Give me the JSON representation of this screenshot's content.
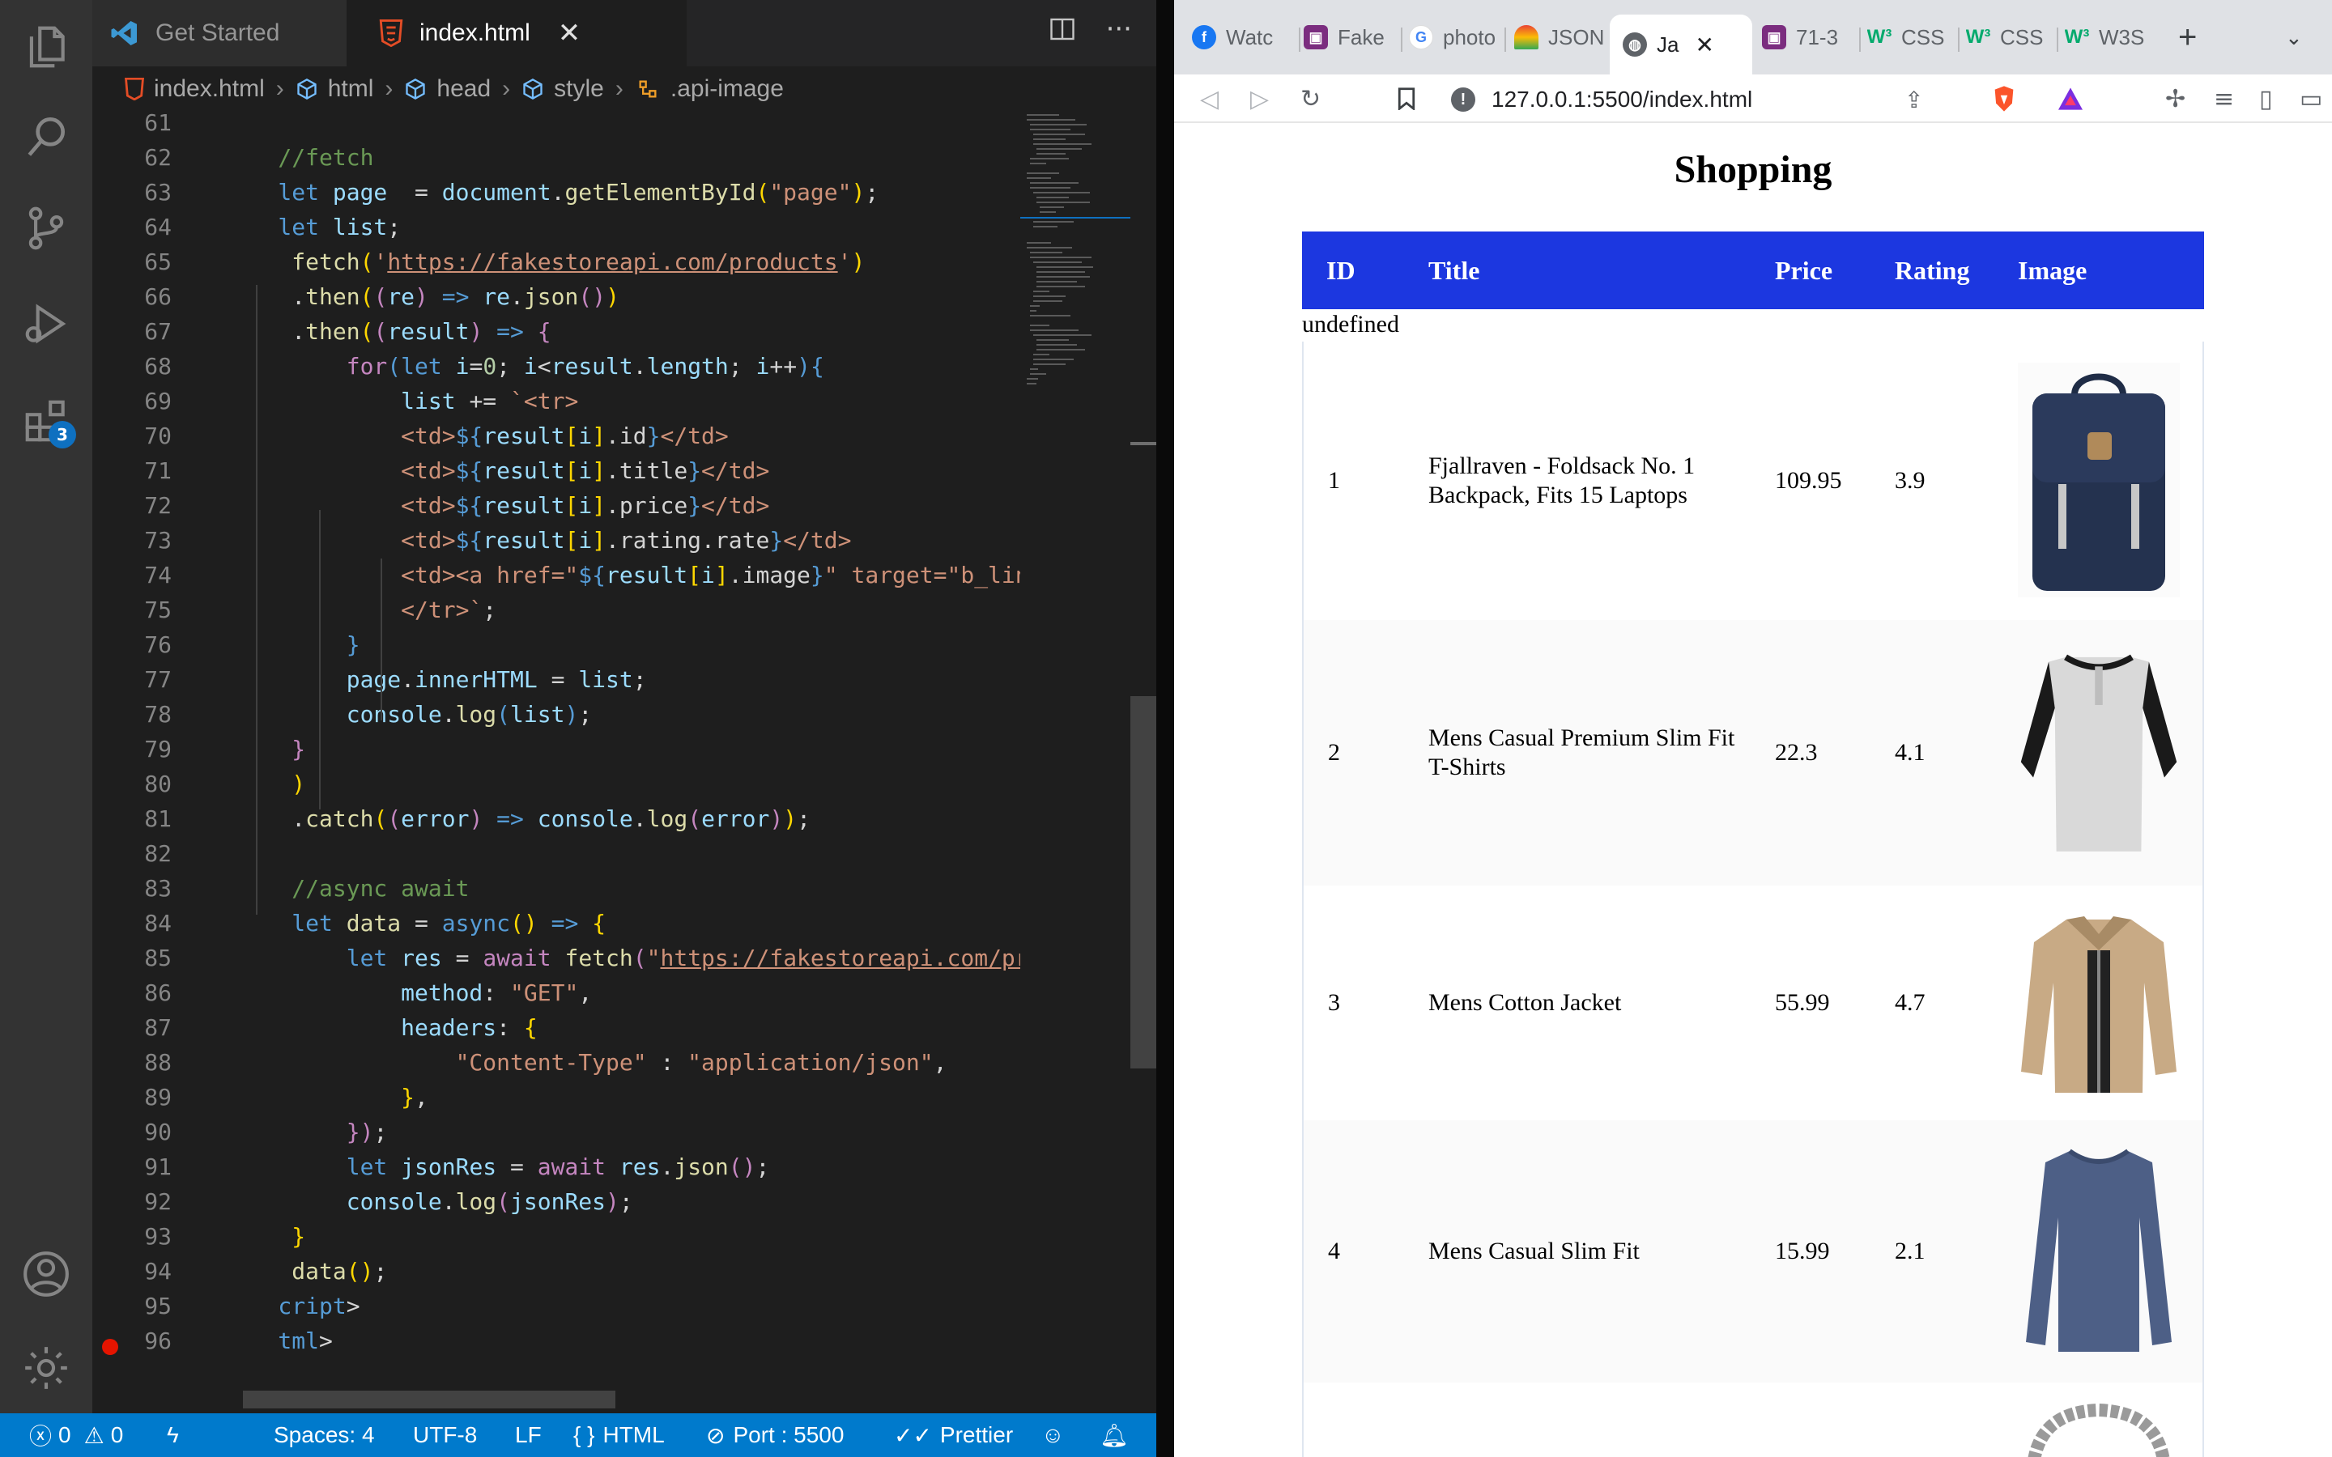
{
  "editor": {
    "tabs": [
      {
        "label": "Get Started"
      },
      {
        "label": "index.html"
      }
    ],
    "breadcrumb": [
      "index.html",
      "html",
      "head",
      "style",
      ".api-image"
    ],
    "activity_badge": "3",
    "lines": [
      {
        "n": "61",
        "segs": []
      },
      {
        "n": "62",
        "segs": [
          [
            "c",
            "    //fetch"
          ]
        ]
      },
      {
        "n": "63",
        "segs": [
          [
            "k",
            "    let "
          ],
          [
            "v",
            "page"
          ],
          [
            "",
            "  = "
          ],
          [
            "v",
            "document"
          ],
          [
            "",
            "."
          ],
          [
            "f",
            "getElementById"
          ],
          [
            "p",
            "("
          ],
          [
            "s",
            "\"page\""
          ],
          [
            "p",
            ")"
          ],
          [
            "",
            ";"
          ]
        ]
      },
      {
        "n": "64",
        "segs": [
          [
            "k",
            "    let "
          ],
          [
            "v",
            "list"
          ],
          [
            "",
            ";"
          ]
        ]
      },
      {
        "n": "65",
        "segs": [
          [
            "",
            "     "
          ],
          [
            "f",
            "fetch"
          ],
          [
            "p",
            "("
          ],
          [
            "s",
            "'"
          ],
          [
            "u",
            "https://fakestoreapi.com/products"
          ],
          [
            "s",
            "'"
          ],
          [
            "p",
            ")"
          ]
        ]
      },
      {
        "n": "66",
        "segs": [
          [
            "",
            "     ."
          ],
          [
            "f",
            "then"
          ],
          [
            "p",
            "("
          ],
          [
            "kw",
            "("
          ],
          [
            "v",
            "re"
          ],
          [
            "kw",
            ")"
          ],
          [
            "k",
            " => "
          ],
          [
            "v",
            "re"
          ],
          [
            "",
            "."
          ],
          [
            "f",
            "json"
          ],
          [
            "kw",
            "()"
          ],
          [
            "p",
            ")"
          ]
        ]
      },
      {
        "n": "67",
        "segs": [
          [
            "",
            "     ."
          ],
          [
            "f",
            "then"
          ],
          [
            "p",
            "("
          ],
          [
            "kw",
            "("
          ],
          [
            "v",
            "result"
          ],
          [
            "kw",
            ")"
          ],
          [
            "k",
            " => "
          ],
          [
            "kw",
            "{"
          ]
        ]
      },
      {
        "n": "68",
        "segs": [
          [
            "kw",
            "         for"
          ],
          [
            "k",
            "("
          ],
          [
            "k",
            "let "
          ],
          [
            "v",
            "i"
          ],
          [
            "",
            "="
          ],
          [
            "n",
            "0"
          ],
          [
            "",
            "; "
          ],
          [
            "v",
            "i"
          ],
          [
            "",
            "<"
          ],
          [
            "v",
            "result"
          ],
          [
            "",
            "."
          ],
          [
            "v",
            "length"
          ],
          [
            "",
            "; "
          ],
          [
            "v",
            "i"
          ],
          [
            "",
            "++"
          ],
          [
            "k",
            ")"
          ],
          [
            "k",
            "{"
          ]
        ]
      },
      {
        "n": "69",
        "segs": [
          [
            "v",
            "             list "
          ],
          [
            "",
            "+= "
          ],
          [
            "s",
            "`<tr>"
          ]
        ]
      },
      {
        "n": "70",
        "segs": [
          [
            "s",
            "             <td>"
          ],
          [
            "k",
            "${"
          ],
          [
            "v",
            "result"
          ],
          [
            "p",
            "["
          ],
          [
            "v",
            "i"
          ],
          [
            "p",
            "]"
          ],
          [
            "",
            ".id"
          ],
          [
            "k",
            "}"
          ],
          [
            "s",
            "</td>"
          ]
        ]
      },
      {
        "n": "71",
        "segs": [
          [
            "s",
            "             <td>"
          ],
          [
            "k",
            "${"
          ],
          [
            "v",
            "result"
          ],
          [
            "p",
            "["
          ],
          [
            "v",
            "i"
          ],
          [
            "p",
            "]"
          ],
          [
            "",
            ".title"
          ],
          [
            "k",
            "}"
          ],
          [
            "s",
            "</td>"
          ]
        ]
      },
      {
        "n": "72",
        "segs": [
          [
            "s",
            "             <td>"
          ],
          [
            "k",
            "${"
          ],
          [
            "v",
            "result"
          ],
          [
            "p",
            "["
          ],
          [
            "v",
            "i"
          ],
          [
            "p",
            "]"
          ],
          [
            "",
            ".price"
          ],
          [
            "k",
            "}"
          ],
          [
            "s",
            "</td>"
          ]
        ]
      },
      {
        "n": "73",
        "segs": [
          [
            "s",
            "             <td>"
          ],
          [
            "k",
            "${"
          ],
          [
            "v",
            "result"
          ],
          [
            "p",
            "["
          ],
          [
            "v",
            "i"
          ],
          [
            "p",
            "]"
          ],
          [
            "",
            ".rating.rate"
          ],
          [
            "k",
            "}"
          ],
          [
            "s",
            "</td>"
          ]
        ]
      },
      {
        "n": "74",
        "segs": [
          [
            "s",
            "             <td><a href=\""
          ],
          [
            "k",
            "${"
          ],
          [
            "v",
            "result"
          ],
          [
            "p",
            "["
          ],
          [
            "v",
            "i"
          ],
          [
            "p",
            "]"
          ],
          [
            "",
            ".image"
          ],
          [
            "k",
            "}"
          ],
          [
            "s",
            "\" target=\"b_link\""
          ]
        ]
      },
      {
        "n": "75",
        "segs": [
          [
            "s",
            "             </tr>`"
          ],
          [
            "",
            ";"
          ]
        ]
      },
      {
        "n": "76",
        "segs": [
          [
            "k",
            "         }"
          ]
        ]
      },
      {
        "n": "77",
        "segs": [
          [
            "v",
            "         page"
          ],
          [
            "",
            "."
          ],
          [
            "v",
            "innerHTML"
          ],
          [
            "",
            " = "
          ],
          [
            "v",
            "list"
          ],
          [
            "",
            ";"
          ]
        ]
      },
      {
        "n": "78",
        "segs": [
          [
            "v",
            "         console"
          ],
          [
            "",
            "."
          ],
          [
            "f",
            "log"
          ],
          [
            "k",
            "("
          ],
          [
            "v",
            "list"
          ],
          [
            "k",
            ")"
          ],
          [
            "",
            ";"
          ]
        ]
      },
      {
        "n": "79",
        "segs": [
          [
            "kw",
            "     }"
          ]
        ]
      },
      {
        "n": "80",
        "segs": [
          [
            "p",
            "     )"
          ]
        ]
      },
      {
        "n": "81",
        "segs": [
          [
            "",
            "     ."
          ],
          [
            "f",
            "catch"
          ],
          [
            "p",
            "("
          ],
          [
            "kw",
            "("
          ],
          [
            "v",
            "error"
          ],
          [
            "kw",
            ")"
          ],
          [
            "k",
            " => "
          ],
          [
            "v",
            "console"
          ],
          [
            "",
            "."
          ],
          [
            "f",
            "log"
          ],
          [
            "kw",
            "("
          ],
          [
            "v",
            "error"
          ],
          [
            "kw",
            ")"
          ],
          [
            "p",
            ")"
          ],
          [
            "",
            ";"
          ]
        ]
      },
      {
        "n": "82",
        "segs": []
      },
      {
        "n": "83",
        "segs": [
          [
            "c",
            "     //async await"
          ]
        ]
      },
      {
        "n": "84",
        "segs": [
          [
            "k",
            "     let "
          ],
          [
            "f",
            "data"
          ],
          [
            "",
            " = "
          ],
          [
            "k",
            "async"
          ],
          [
            "p",
            "()"
          ],
          [
            "k",
            " => "
          ],
          [
            "p",
            "{"
          ]
        ]
      },
      {
        "n": "85",
        "segs": [
          [
            "k",
            "         let "
          ],
          [
            "v",
            "res"
          ],
          [
            "",
            " = "
          ],
          [
            "kw",
            "await "
          ],
          [
            "f",
            "fetch"
          ],
          [
            "kw",
            "("
          ],
          [
            "s",
            "\""
          ],
          [
            "u",
            "https://fakestoreapi.com/prod"
          ]
        ]
      },
      {
        "n": "86",
        "segs": [
          [
            "v",
            "             method"
          ],
          [
            "",
            ": "
          ],
          [
            "s",
            "\"GET\""
          ],
          [
            "",
            ","
          ]
        ]
      },
      {
        "n": "87",
        "segs": [
          [
            "v",
            "             headers"
          ],
          [
            "",
            ": "
          ],
          [
            "p",
            "{"
          ]
        ]
      },
      {
        "n": "88",
        "segs": [
          [
            "s",
            "                 \"Content-Type\""
          ],
          [
            "",
            " : "
          ],
          [
            "s",
            "\"application/json\""
          ],
          [
            "",
            ","
          ]
        ]
      },
      {
        "n": "89",
        "segs": [
          [
            "p",
            "             }"
          ],
          [
            "",
            ","
          ]
        ]
      },
      {
        "n": "90",
        "segs": [
          [
            "kw",
            "         })"
          ],
          [
            "",
            ";"
          ]
        ]
      },
      {
        "n": "91",
        "segs": [
          [
            "k",
            "         let "
          ],
          [
            "v",
            "jsonRes"
          ],
          [
            "",
            " = "
          ],
          [
            "kw",
            "await "
          ],
          [
            "v",
            "res"
          ],
          [
            "",
            "."
          ],
          [
            "f",
            "json"
          ],
          [
            "kw",
            "()"
          ],
          [
            "",
            ";"
          ]
        ]
      },
      {
        "n": "92",
        "segs": [
          [
            "v",
            "         console"
          ],
          [
            "",
            "."
          ],
          [
            "f",
            "log"
          ],
          [
            "kw",
            "("
          ],
          [
            "v",
            "jsonRes"
          ],
          [
            "kw",
            ")"
          ],
          [
            "",
            ";"
          ]
        ]
      },
      {
        "n": "93",
        "segs": [
          [
            "p",
            "     }"
          ]
        ]
      },
      {
        "n": "94",
        "segs": [
          [
            "f",
            "     data"
          ],
          [
            "p",
            "()"
          ],
          [
            "",
            ";"
          ]
        ]
      },
      {
        "n": "95",
        "segs": [
          [
            "t",
            "    cript"
          ],
          [
            "",
            ">"
          ]
        ]
      },
      {
        "n": "96",
        "segs": [
          [
            "t",
            "    tml"
          ],
          [
            "",
            ">"
          ]
        ]
      }
    ],
    "status": {
      "errors": "0",
      "warnings": "0",
      "spaces": "Spaces: 4",
      "encoding": "UTF-8",
      "eol": "LF",
      "language": "HTML",
      "port": "Port : 5500",
      "formatter": "Prettier"
    }
  },
  "browser": {
    "tabs": [
      {
        "label": "Watc",
        "icon": "facebook-icon",
        "color": "#1877f2"
      },
      {
        "label": "Fake",
        "icon": "site-icon",
        "color": "#7b2d7f"
      },
      {
        "label": "photo",
        "icon": "google-icon",
        "color": "#4285f4"
      },
      {
        "label": "JSON",
        "icon": "rainbow-icon",
        "color": "#f4b400"
      },
      {
        "label": "Ja",
        "icon": "globe-icon",
        "color": "#5f6368"
      },
      {
        "label": "71-3",
        "icon": "site-icon",
        "color": "#7b2d7f"
      },
      {
        "label": "CSS",
        "icon": "w3schools-icon",
        "color": "#04aa6d"
      },
      {
        "label": "CSS",
        "icon": "w3schools-icon",
        "color": "#04aa6d"
      },
      {
        "label": "W3S",
        "icon": "w3schools-icon",
        "color": "#04aa6d"
      }
    ],
    "url": "127.0.0.1:5500/index.html"
  },
  "shop": {
    "title": "Shopping",
    "headers": [
      "ID",
      "Title",
      "Price",
      "Rating",
      "Image"
    ],
    "undefined_text": "undefined",
    "products": [
      {
        "id": "1",
        "title": "Fjallraven - Foldsack No. 1 Backpack, Fits 15 Laptops",
        "price": "109.95",
        "rating": "3.9"
      },
      {
        "id": "2",
        "title": "Mens Casual Premium Slim Fit T-Shirts",
        "price": "22.3",
        "rating": "4.1"
      },
      {
        "id": "3",
        "title": "Mens Cotton Jacket",
        "price": "55.99",
        "rating": "4.7"
      },
      {
        "id": "4",
        "title": "Mens Casual Slim Fit",
        "price": "15.99",
        "rating": "2.1"
      }
    ]
  }
}
